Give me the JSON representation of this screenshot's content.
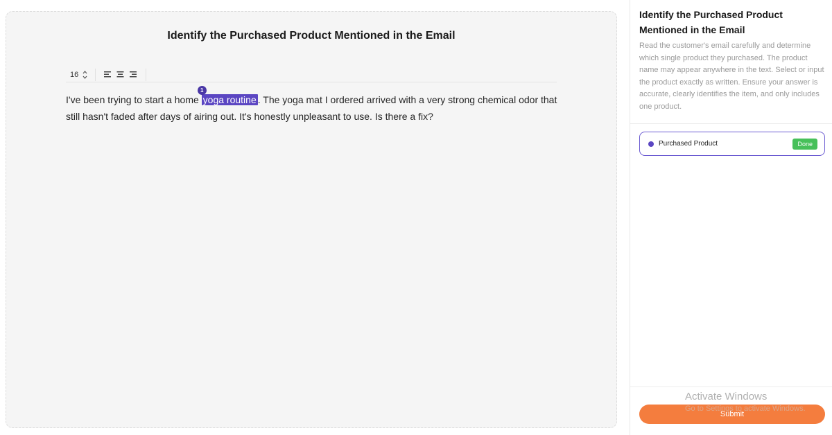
{
  "task": {
    "title": "Identify the Purchased Product Mentioned in the Email"
  },
  "toolbar": {
    "font_size": "16",
    "stepper_icon": "chevron-up-down-icon",
    "align_left_icon": "align-left-icon",
    "align_center_icon": "align-center-icon",
    "align_right_icon": "align-right-icon"
  },
  "email": {
    "before": "I've been trying to start a home ",
    "highlight": "yoga routine",
    "highlight_index": "1",
    "after": ". The yoga mat I ordered arrived with a very strong chemical odor that still hasn't faded after days of airing out. It's honestly unpleasant to use. Is there a fix?",
    "highlight_color": "#5b46c2"
  },
  "sidebar": {
    "title": "Identify the Purchased Product Mentioned in the Email",
    "description": "Read the customer's email carefully and determine which single product they purchased. The product name may appear anywhere in the text. Select or input the product exactly as written. Ensure your answer is accurate, clearly identifies the item, and only includes one product.",
    "field": {
      "label": "Purchased Product",
      "status": "Done",
      "status_color": "#47c05a"
    },
    "submit_label": "Submit",
    "submit_color": "#f47d3e"
  },
  "watermark": {
    "title": "Activate Windows",
    "subtitle": "Go to Settings to activate Windows."
  }
}
